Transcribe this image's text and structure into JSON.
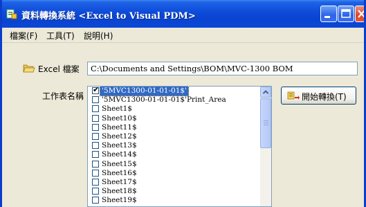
{
  "window": {
    "title": "資料轉換系統  <Excel to Visual PDM>"
  },
  "menu": {
    "items": [
      {
        "label": "檔案(F)"
      },
      {
        "label": "工具(T)"
      },
      {
        "label": "說明(H)"
      }
    ]
  },
  "form": {
    "excel_label": "Excel 檔案",
    "path_value": "C:\\Documents and Settings\\BOM\\MVC-1300 BOM",
    "sheet_label": "工作表名稱",
    "start_button": "開始轉換(T)"
  },
  "sheets": [
    {
      "name": "'5MVC1300-01-01-01$'",
      "checked": true,
      "selected": true
    },
    {
      "name": "'5MVC1300-01-01-01$'Print_Area",
      "checked": false,
      "selected": false
    },
    {
      "name": "Sheet1$",
      "checked": false,
      "selected": false
    },
    {
      "name": "Sheet10$",
      "checked": false,
      "selected": false
    },
    {
      "name": "Sheet11$",
      "checked": false,
      "selected": false
    },
    {
      "name": "Sheet12$",
      "checked": false,
      "selected": false
    },
    {
      "name": "Sheet13$",
      "checked": false,
      "selected": false
    },
    {
      "name": "Sheet14$",
      "checked": false,
      "selected": false
    },
    {
      "name": "Sheet15$",
      "checked": false,
      "selected": false
    },
    {
      "name": "Sheet16$",
      "checked": false,
      "selected": false
    },
    {
      "name": "Sheet17$",
      "checked": false,
      "selected": false
    },
    {
      "name": "Sheet18$",
      "checked": false,
      "selected": false
    },
    {
      "name": "Sheet19$",
      "checked": false,
      "selected": false
    }
  ],
  "icons": {
    "app": "app-icon",
    "folder": "folder-open-icon",
    "start": "convert-icon",
    "minimize": "minimize-icon",
    "maximize": "maximize-icon",
    "close": "close-icon",
    "scroll_up": "chevron-up-icon"
  },
  "colors": {
    "titlebar": "#0a43d0",
    "selection": "#316ac5",
    "close_button": "#d8482a"
  }
}
